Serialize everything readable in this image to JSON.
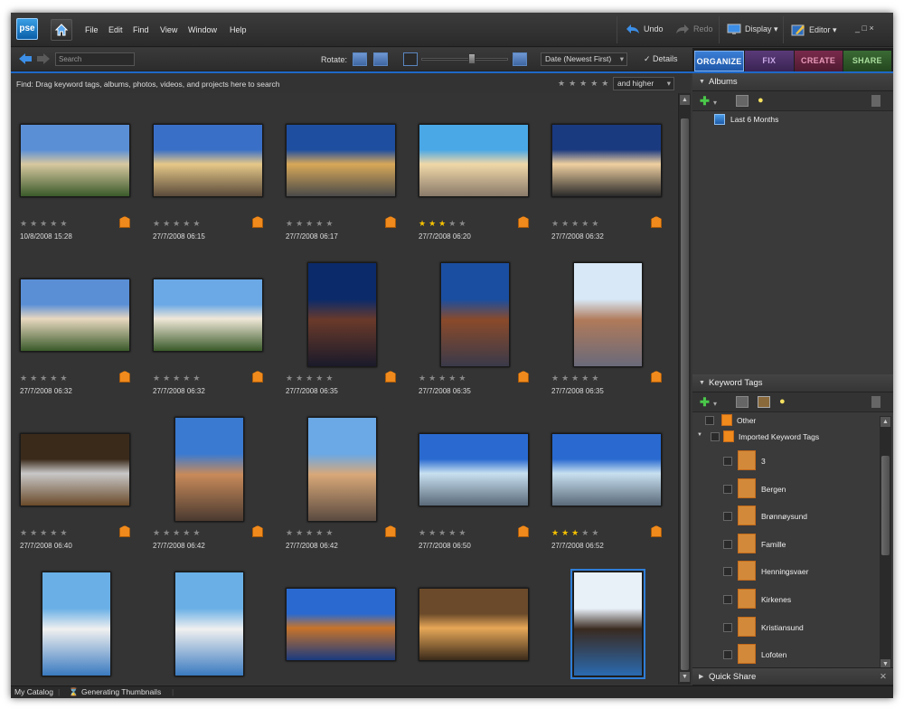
{
  "app": {
    "logo": "pse"
  },
  "menu": [
    "File",
    "Edit",
    "Find",
    "View",
    "Window",
    "Help"
  ],
  "topbar": {
    "undo": "Undo",
    "redo": "Redo",
    "display": "Display ▾",
    "editor": "Editor ▾",
    "win_controls": "_ □ ×"
  },
  "toolbar": {
    "search_placeholder": "Search",
    "rotate_label": "Rotate:",
    "sort": "Date (Newest First)",
    "details": "Details"
  },
  "tabs": [
    "ORGANIZE",
    "FIX",
    "CREATE",
    "SHARE"
  ],
  "find": {
    "text": "Find: Drag keyword tags, albums, photos, videos, and projects here to search",
    "stars": "★★★★★",
    "filter": "and higher"
  },
  "photos": [
    {
      "date": "10/8/2008 15:28",
      "rating": 0
    },
    {
      "date": "27/7/2008 06:15",
      "rating": 0
    },
    {
      "date": "27/7/2008 06:17",
      "rating": 0
    },
    {
      "date": "27/7/2008 06:20",
      "rating": 3
    },
    {
      "date": "27/7/2008 06:32",
      "rating": 0
    },
    {
      "date": "27/7/2008 06:32",
      "rating": 0
    },
    {
      "date": "27/7/2008 06:32",
      "rating": 0
    },
    {
      "date": "27/7/2008 06:35",
      "rating": 0
    },
    {
      "date": "27/7/2008 06:35",
      "rating": 0
    },
    {
      "date": "27/7/2008 06:35",
      "rating": 0
    },
    {
      "date": "27/7/2008 06:40",
      "rating": 0
    },
    {
      "date": "27/7/2008 06:42",
      "rating": 0
    },
    {
      "date": "27/7/2008 06:42",
      "rating": 0
    },
    {
      "date": "27/7/2008 06:50",
      "rating": 0
    },
    {
      "date": "27/7/2008 06:52",
      "rating": 3
    },
    {
      "date": "",
      "rating": 0
    },
    {
      "date": "",
      "rating": 0
    },
    {
      "date": "",
      "rating": 0
    },
    {
      "date": "",
      "rating": 0
    },
    {
      "date": "",
      "rating": 0
    }
  ],
  "albums": {
    "title": "Albums",
    "items": [
      "Last 6 Months"
    ]
  },
  "keyword_tags": {
    "title": "Keyword Tags",
    "items": [
      "Other",
      "Imported Keyword Tags",
      "3",
      "Bergen",
      "Brønnøysund",
      "Famille",
      "Henningsvaer",
      "Kirkenes",
      "Kristiansund",
      "Lofoten"
    ]
  },
  "quick_share": "Quick Share",
  "status": {
    "catalog": "My Catalog",
    "task": "Generating Thumbnails"
  },
  "colors": {
    "accent": "#1e68c8",
    "tag": "#f08a1c",
    "star": "#f5c200"
  }
}
